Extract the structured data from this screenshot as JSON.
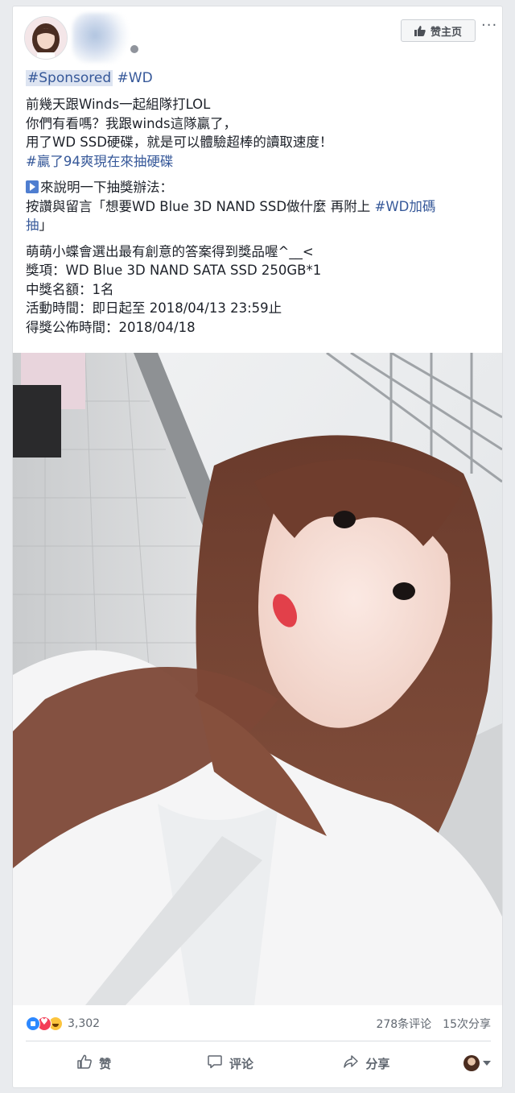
{
  "header": {
    "like_page_label": "赞主页",
    "more_label": "···"
  },
  "tags": {
    "sponsored": "#Sponsored",
    "wd": "#WD"
  },
  "post": {
    "line1": "前幾天跟Winds一起組隊打LOL",
    "line2": "你們有看嗎？我跟winds這隊贏了，",
    "line3": "用了WD SSD硬碟，就是可以體驗超棒的讀取速度！",
    "hashtag_win": "#贏了94爽現在來抽硬碟",
    "line5": "來說明一下抽獎辦法：",
    "line6_prefix": "按讚與留言「想要WD Blue 3D NAND SSD做什麼 再附上 ",
    "hashtag_wd_extra_part1": "#WD加碼",
    "hashtag_wd_extra_part2": "抽",
    "line7_suffix": "」",
    "line8": "萌萌小蝶會選出最有創意的答案得到獎品喔^__<",
    "line9": "獎項：WD Blue 3D NAND SATA SSD 250GB*1",
    "line10": "中獎名額：1名",
    "line11": "活動時間：即日起至 2018/04/13 23:59止",
    "line12": "得獎公佈時間：2018/04/18"
  },
  "stats": {
    "reaction_count": "3,302",
    "comments": "278条评论",
    "shares": "15次分享"
  },
  "actions": {
    "like": "赞",
    "comment": "评论",
    "share": "分享"
  },
  "colors": {
    "link": "#365899",
    "muted": "#606770",
    "background": "#e9ebee"
  }
}
